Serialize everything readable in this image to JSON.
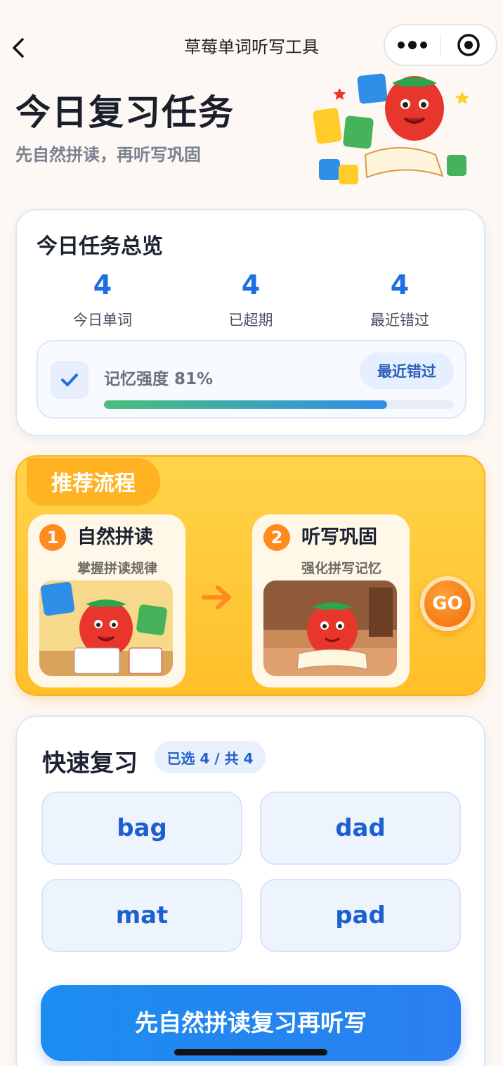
{
  "nav": {
    "title": "草莓单词听写工具"
  },
  "header": {
    "title": "今日复习任务",
    "subtitle": "先自然拼读，再听写巩固"
  },
  "overview": {
    "title": "今日任务总览",
    "stats": [
      {
        "value": "4",
        "label": "今日单词"
      },
      {
        "value": "4",
        "label": "已超期"
      },
      {
        "value": "4",
        "label": "最近错过"
      }
    ],
    "memory": {
      "label": "记忆强度 81%",
      "percent": 81,
      "tag": "最近错过"
    }
  },
  "flow": {
    "tag": "推荐流程",
    "steps": [
      {
        "num": "1",
        "title": "自然拼读",
        "sub": "掌握拼读规律"
      },
      {
        "num": "2",
        "title": "听写巩固",
        "sub": "强化拼写记忆"
      }
    ],
    "go": "GO"
  },
  "quick": {
    "title": "快速复习",
    "badge": "已选 4 / 共 4",
    "words": [
      "bag",
      "dad",
      "mat",
      "pad"
    ]
  },
  "cta": {
    "label": "先自然拼读复习再听写"
  },
  "colors": {
    "accent": "#1f6fe0",
    "orange": "#ff8a1e",
    "yellow": "#ffc933"
  }
}
